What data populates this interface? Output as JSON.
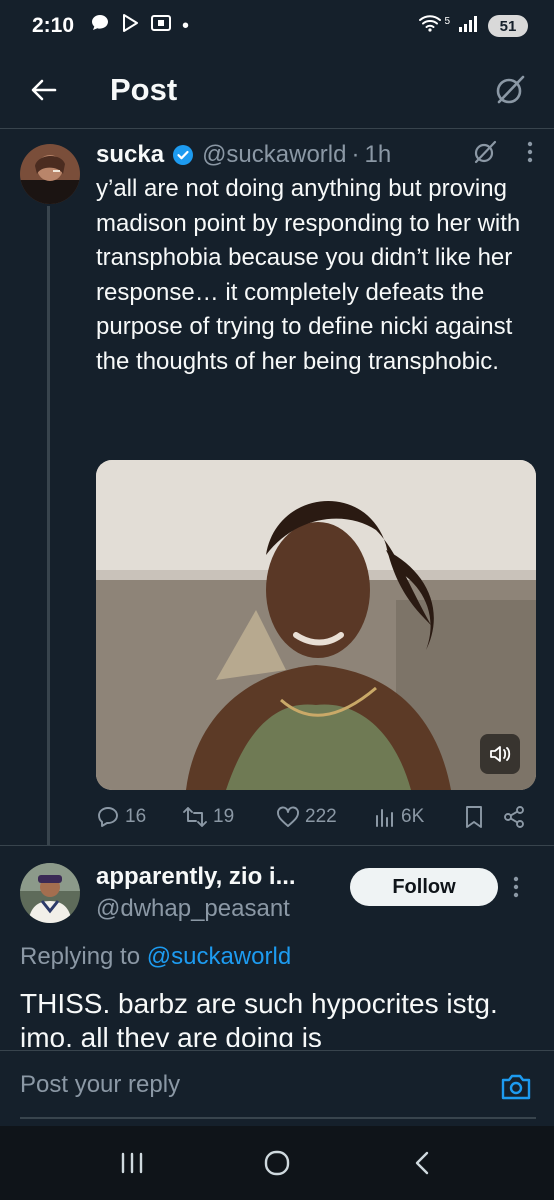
{
  "status_bar": {
    "time": "2:10",
    "dot": "•",
    "signal_label": "5",
    "battery": "51",
    "icons": [
      "chat-bubble-icon",
      "play-store-icon",
      "screenshot-icon",
      "wifi-icon",
      "signal-icon",
      "battery-icon"
    ]
  },
  "header": {
    "title": "Post",
    "back_icon": "arrow-left-icon",
    "right_icon": "grok-icon"
  },
  "tweet": {
    "display_name": "sucka",
    "handle": "@suckaworld",
    "separator": "·",
    "time": "1h",
    "text": "y’all are not doing anything but proving madison point by responding to her with transphobia because you didn’t like her response… it completely defeats the purpose of trying to define nicki against the thoughts of her being transphobic.",
    "actions": {
      "replies": "16",
      "reposts": "19",
      "likes": "222",
      "views": "6K"
    }
  },
  "reply": {
    "display_name": "apparently, zio i...",
    "handle": "@dwhap_peasant",
    "follow_label": "Follow",
    "replying_prefix": "Replying to ",
    "replying_mention": "@suckaworld",
    "text": "THISS. barbz are such hypocrites istg. imo, all they are doing is"
  },
  "composer": {
    "placeholder": "Post your reply"
  },
  "colors": {
    "background": "#15202b",
    "accent": "#1d9bf0",
    "muted": "#8b98a5"
  }
}
